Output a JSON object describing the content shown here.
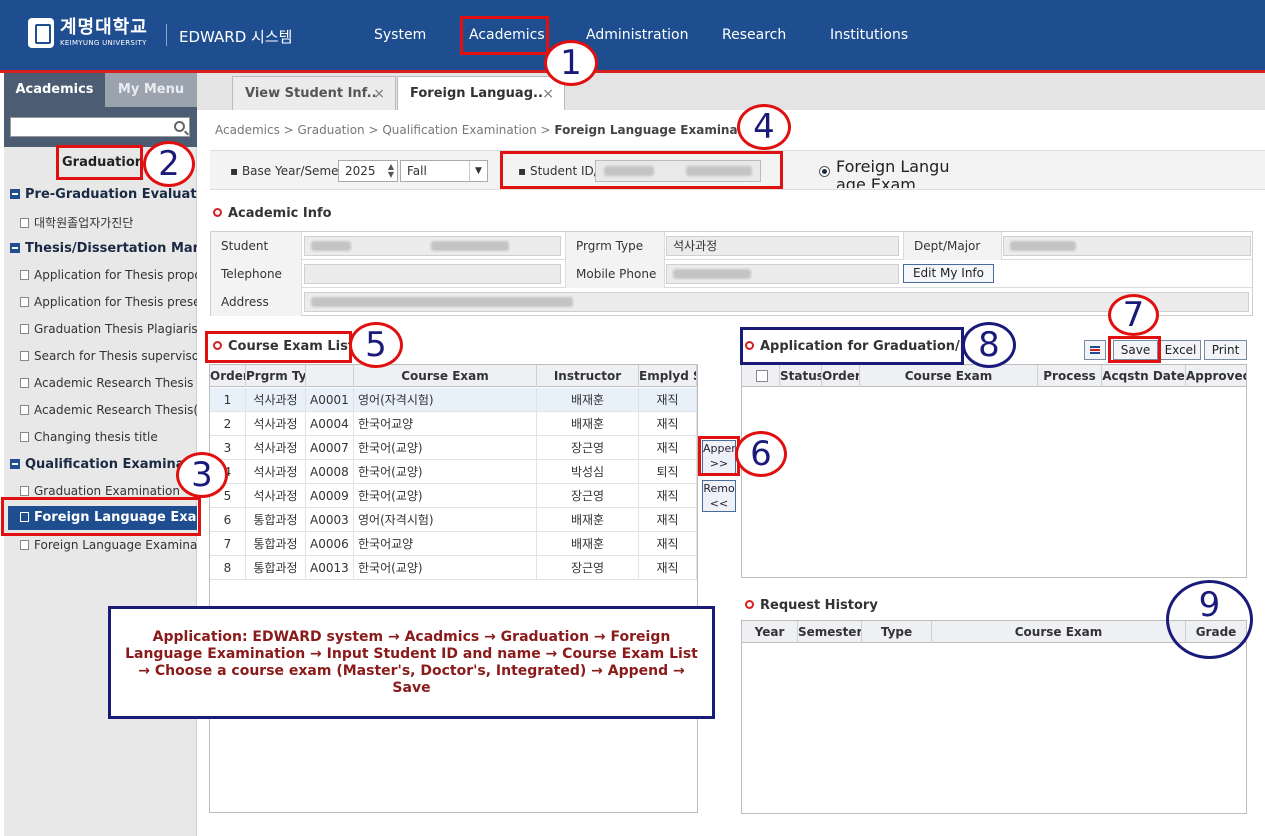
{
  "header": {
    "university_kr": "계명대학교",
    "university_en": "KEIMYUNG UNIVERSITY",
    "system_name": "EDWARD 시스템",
    "nav": [
      "System",
      "Academics",
      "Administration",
      "Research",
      "Institutions"
    ]
  },
  "sidebar": {
    "tabs": [
      "Academics",
      "My Menu"
    ],
    "search_placeholder": "",
    "section": "Graduation",
    "groups": [
      {
        "label": "Pre-Graduation Evaluation",
        "items": [
          "대학원졸업자가진단"
        ]
      },
      {
        "label": "Thesis/Dissertation Mang",
        "items": [
          "Application for Thesis propos",
          "Application for Thesis preser",
          "Graduation Thesis Plagiarism",
          "Search for Thesis supervisor",
          "Academic Research Thesis",
          "Academic Research Thesis(I",
          "Changing thesis title"
        ]
      },
      {
        "label": "Qualification Examination",
        "items": [
          "Graduation Examination",
          "Foreign Language Exami",
          "Foreign Language Examinatic"
        ]
      }
    ],
    "active_item": "Foreign Language Exami"
  },
  "tabs": [
    {
      "label": "View Student Inf..",
      "close": "×"
    },
    {
      "label": "Foreign Languag..",
      "close": "×"
    }
  ],
  "breadcrumb": {
    "path": "Academics > Graduation > Qualification Examination > ",
    "current": "Foreign Language Examination"
  },
  "search": {
    "year_label": "Base Year/Seme",
    "year": "2025",
    "semester": "Fall",
    "student_id_label": "Student ID/",
    "radio_label": "Foreign Langu age Exam"
  },
  "academic_info": {
    "title": "Academic Info",
    "labels": {
      "student_id": "Student ID/Na",
      "program_type": "Prgrm Type",
      "dept": "Dept/Major",
      "telephone": "Telephone",
      "mobile": "Mobile Phone",
      "address": "Address"
    },
    "program_type_value": "석사과정",
    "edit_button": "Edit My Info"
  },
  "course_exam_list": {
    "title": "Course Exam List",
    "columns": [
      "Order",
      "Prgrm Ty",
      "",
      "Course Exam",
      "Instructor",
      "Emplyd S"
    ],
    "rows": [
      {
        "order": "1",
        "program": "석사과정",
        "code": "A0001",
        "exam": "영어(자격시험)",
        "instructor": "배재훈",
        "status": "재직"
      },
      {
        "order": "2",
        "program": "석사과정",
        "code": "A0004",
        "exam": "한국어교양",
        "instructor": "배재훈",
        "status": "재직"
      },
      {
        "order": "3",
        "program": "석사과정",
        "code": "A0007",
        "exam": "한국어(교양)",
        "instructor": "장근영",
        "status": "재직"
      },
      {
        "order": "4",
        "program": "석사과정",
        "code": "A0008",
        "exam": "한국어(교양)",
        "instructor": "박성심",
        "status": "퇴직"
      },
      {
        "order": "5",
        "program": "석사과정",
        "code": "A0009",
        "exam": "한국어(교양)",
        "instructor": "장근영",
        "status": "재직"
      },
      {
        "order": "6",
        "program": "통합과정",
        "code": "A0003",
        "exam": "영어(자격시험)",
        "instructor": "배재훈",
        "status": "재직"
      },
      {
        "order": "7",
        "program": "통합과정",
        "code": "A0006",
        "exam": "한국어교양",
        "instructor": "배재훈",
        "status": "재직"
      },
      {
        "order": "8",
        "program": "통합과정",
        "code": "A0013",
        "exam": "한국어(교양)",
        "instructor": "장근영",
        "status": "재직"
      }
    ]
  },
  "transfer": {
    "append": "Apper >>",
    "remove": "Remo <<"
  },
  "application": {
    "title": "Application for Graduation/For",
    "buttons": {
      "save": "Save",
      "excel": "Excel",
      "print": "Print"
    },
    "columns": [
      "",
      "Status",
      "Order",
      "Course Exam",
      "Process",
      "Acqstn Date",
      "Approved"
    ]
  },
  "request_history": {
    "title": "Request History",
    "columns": [
      "Year",
      "Semester",
      "Type",
      "Course Exam",
      "Grade"
    ]
  },
  "annotations": {
    "numbers": [
      "1",
      "2",
      "3",
      "4",
      "5",
      "6",
      "7",
      "8",
      "9"
    ],
    "note": "Application: EDWARD system → Acadmics → Graduation → Foreign Language Examination → Input Student ID and name → Course Exam List → Choose a course exam (Master's, Doctor's, Integrated) → Append → Save"
  },
  "colors": {
    "header": "#1e4e8f",
    "accent": "#d62020",
    "annotation": "#e01010",
    "annotation_navy": "#1a1a7a"
  }
}
